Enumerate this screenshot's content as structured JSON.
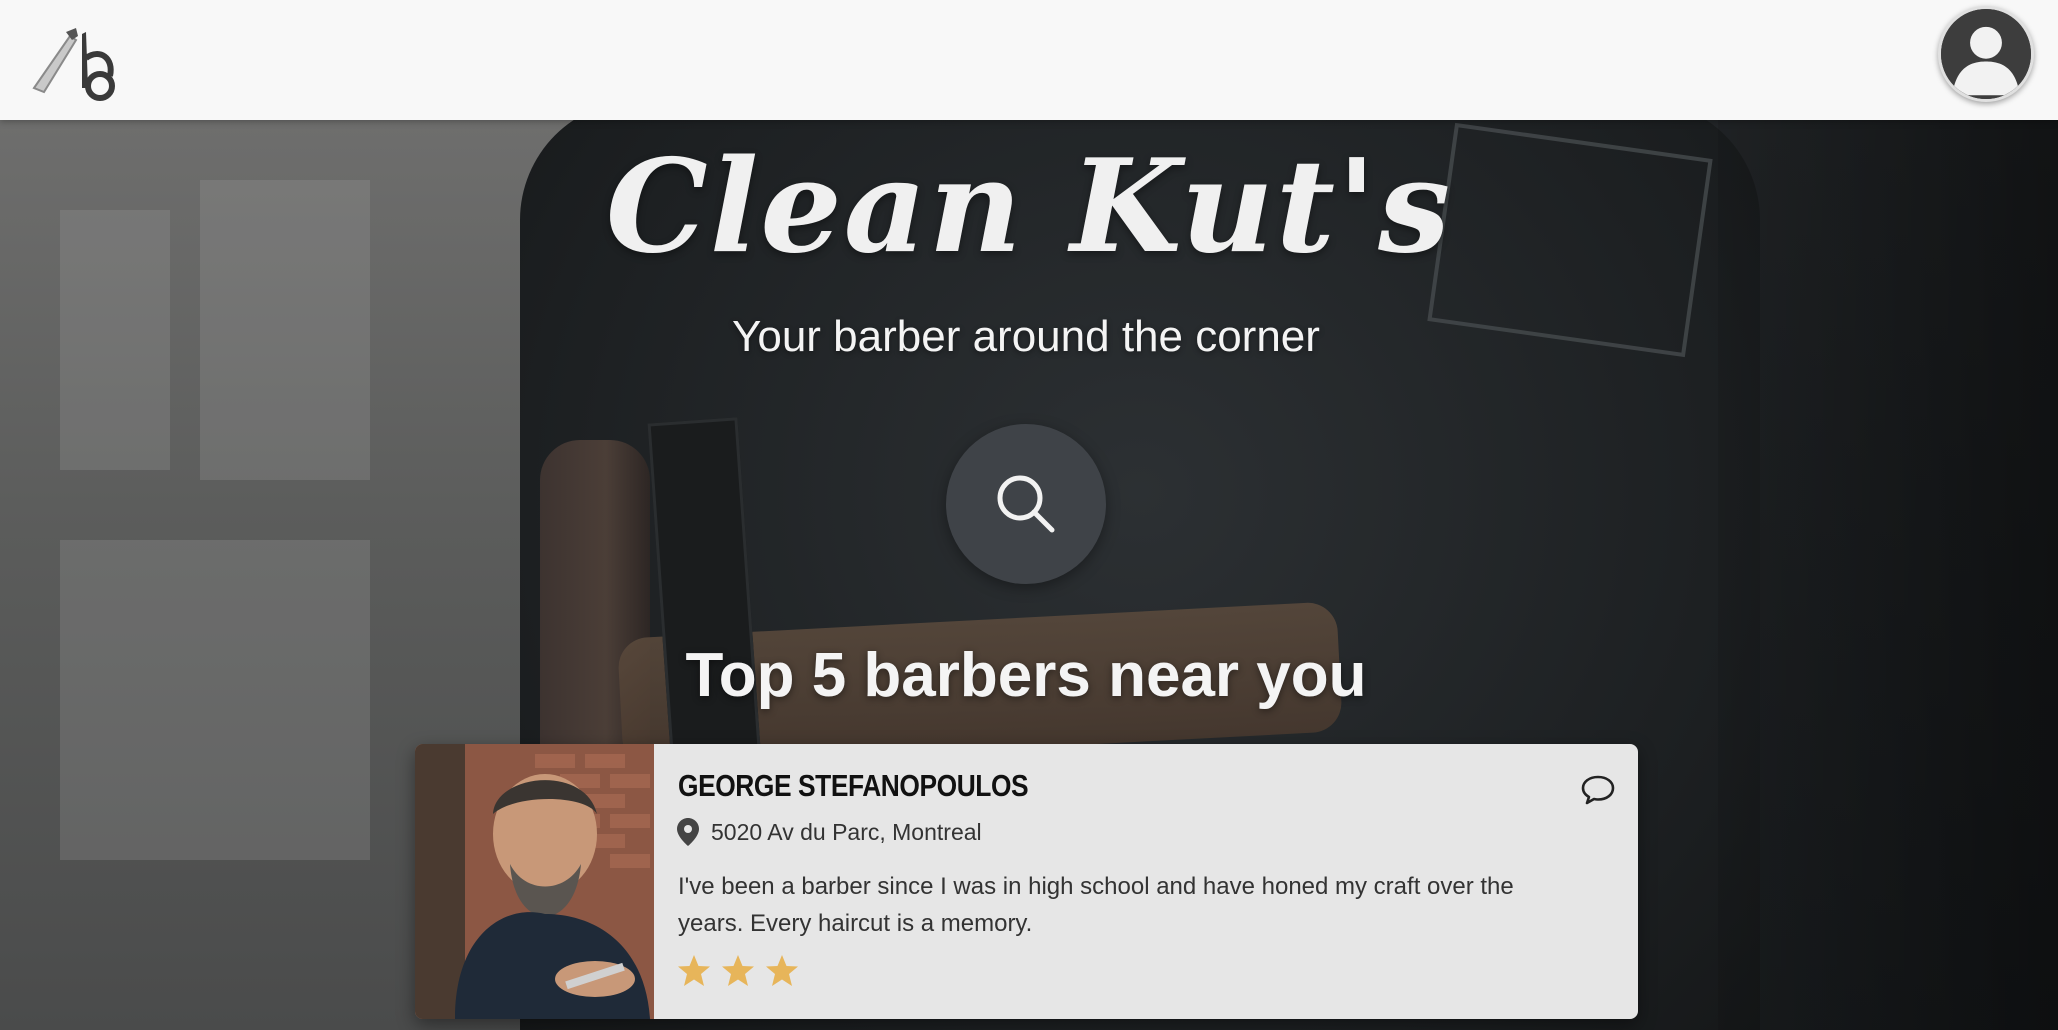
{
  "header": {
    "logo_icon": "razor-scissors-logo-icon",
    "avatar_icon": "user-avatar-icon"
  },
  "hero": {
    "brand_title": "Clean Kut's",
    "tagline": "Your barber around the corner",
    "search_icon": "search-icon",
    "section_title": "Top 5 barbers near you"
  },
  "barbers": [
    {
      "name": "GEORGE STEFANOPOULOS",
      "address": "5020 Av du Parc, Montreal",
      "bio": "I've been a barber since I was in high school and have honed my craft over the years. Every haircut is a memory.",
      "rating": 3,
      "chat_icon": "chat-bubble-icon",
      "pin_icon": "location-pin-icon"
    }
  ],
  "colors": {
    "header_bg": "#f8f8f8",
    "card_bg": "#e6e6e6",
    "star": "#e7b55a",
    "search_bg": "#3f4348"
  }
}
